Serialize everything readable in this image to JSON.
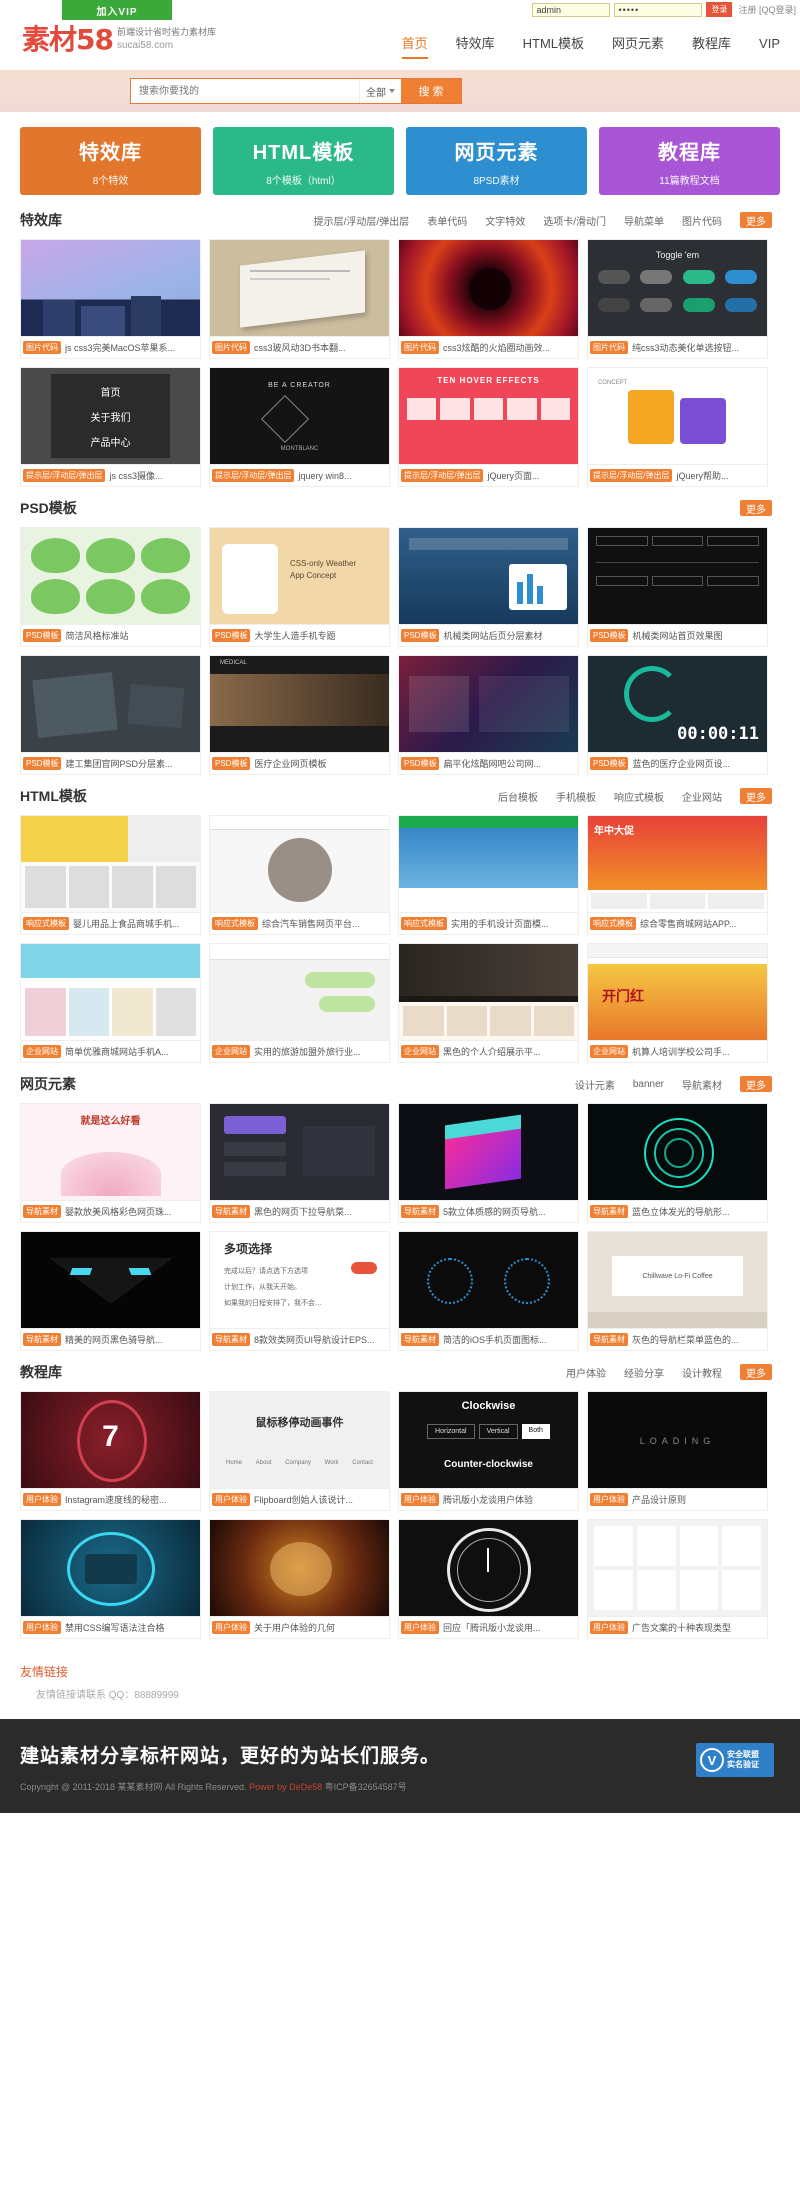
{
  "topbar": {
    "vip_button": "加入VIP",
    "username_value": "admin",
    "password_value": "•••••",
    "login_button": "登录",
    "register_link": "注册 [QQ登录]"
  },
  "header": {
    "logo_main": "素材58",
    "logo_tagline": "前端设计省时省力素材库",
    "logo_url": "sucai58.com",
    "nav": [
      {
        "label": "首页",
        "active": true
      },
      {
        "label": "特效库",
        "active": false
      },
      {
        "label": "HTML模板",
        "active": false
      },
      {
        "label": "网页元素",
        "active": false
      },
      {
        "label": "教程库",
        "active": false
      },
      {
        "label": "VIP",
        "active": false
      }
    ]
  },
  "search": {
    "placeholder": "搜索你要找的",
    "scope": "全部",
    "button": "搜 索"
  },
  "categories": [
    {
      "title": "特效库",
      "subtitle": "8个特效",
      "color": "#e2762c"
    },
    {
      "title": "HTML模板",
      "subtitle": "8个模板（html）",
      "color": "#2bb98a"
    },
    {
      "title": "网页元素",
      "subtitle": "8PSD素材",
      "color": "#2e8fd0"
    },
    {
      "title": "教程库",
      "subtitle": "11篇教程文档",
      "color": "#a855d6"
    }
  ],
  "sections": [
    {
      "title": "特效库",
      "tags": [
        "提示层/浮动层/弹出层",
        "表单代码",
        "文字特效",
        "选项卡/滑动门",
        "导航菜单",
        "图片代码"
      ],
      "more": "更多",
      "cards": [
        {
          "tag": "图片代码",
          "title": "js css3完美MacOS苹果系..."
        },
        {
          "tag": "图片代码",
          "title": "css3玻风动3D书本翻..."
        },
        {
          "tag": "图片代码",
          "title": "css3炫酷的火焰圈动画效..."
        },
        {
          "tag": "图片代码",
          "title": "纯css3动态美化单选按钮..."
        },
        {
          "tag": "提示层/浮动层/弹出层",
          "title": "js css3摄像..."
        },
        {
          "tag": "提示层/浮动层/弹出层",
          "title": "jquery win8..."
        },
        {
          "tag": "提示层/浮动层/弹出层",
          "title": "jQuery页面..."
        },
        {
          "tag": "提示层/浮动层/弹出层",
          "title": "jQuery帮助..."
        }
      ]
    },
    {
      "title": "PSD模板",
      "tags": [],
      "more": "更多",
      "cards": [
        {
          "tag": "PSD模板",
          "title": "简洁风格标准站"
        },
        {
          "tag": "PSD模板",
          "title": "大学生人造手机专题"
        },
        {
          "tag": "PSD模板",
          "title": "机械类网站后页分层素材"
        },
        {
          "tag": "PSD模板",
          "title": "机械类网站首页效果图"
        },
        {
          "tag": "PSD模板",
          "title": "建工集团官网PSD分层素..."
        },
        {
          "tag": "PSD模板",
          "title": "医疗企业网页模板"
        },
        {
          "tag": "PSD模板",
          "title": "扁平化炫酷网吧公司网..."
        },
        {
          "tag": "PSD模板",
          "title": "蓝色的医疗企业网页设..."
        }
      ]
    },
    {
      "title": "HTML模板",
      "tags": [
        "后台模板",
        "手机模板",
        "响应式模板",
        "企业网站"
      ],
      "more": "更多",
      "cards": [
        {
          "tag": "响应式模板",
          "title": "婴儿用品上食品商城手机..."
        },
        {
          "tag": "响应式模板",
          "title": "综合汽车销售网页平台..."
        },
        {
          "tag": "响应式模板",
          "title": "实用的手机设计页面模..."
        },
        {
          "tag": "响应式模板",
          "title": "综合零售商城网站APP..."
        },
        {
          "tag": "企业网站",
          "title": "简单优雅商城网站手机A..."
        },
        {
          "tag": "企业网站",
          "title": "实用的旅游加盟外旅行业..."
        },
        {
          "tag": "企业网站",
          "title": "黑色的个人介绍展示平..."
        },
        {
          "tag": "企业网站",
          "title": "机算人培训学校公司手..."
        }
      ]
    },
    {
      "title": "网页元素",
      "tags": [
        "设计元素",
        "banner",
        "导航素材"
      ],
      "more": "更多",
      "cards": [
        {
          "tag": "导航素材",
          "title": "婴款放美风格彩色网页珠..."
        },
        {
          "tag": "导航素材",
          "title": "黑色的网页下拉导航菜..."
        },
        {
          "tag": "导航素材",
          "title": "5款立体质感的网页导航..."
        },
        {
          "tag": "导航素材",
          "title": "蓝色立体发光的导航形..."
        },
        {
          "tag": "导航素材",
          "title": "精美的网页黑色骑导航..."
        },
        {
          "tag": "导航素材",
          "title": "8款效类网页UI导航设计EPS..."
        },
        {
          "tag": "导航素材",
          "title": "简洁的iOS手机页面图标..."
        },
        {
          "tag": "导航素材",
          "title": "灰色的导航栏菜单蓝色的..."
        }
      ]
    },
    {
      "title": "教程库",
      "tags": [
        "用户体验",
        "经验分享",
        "设计教程"
      ],
      "more": "更多",
      "cards": [
        {
          "tag": "用户体验",
          "title": "Instagram速度线的秘密..."
        },
        {
          "tag": "用户体验",
          "title": "Flipboard创始人该说计..."
        },
        {
          "tag": "用户体验",
          "title": "腾讯版小龙谈用户体验"
        },
        {
          "tag": "用户体验",
          "title": "产品设计原则"
        },
        {
          "tag": "用户体验",
          "title": "禁用CSS编写语法注合格"
        },
        {
          "tag": "用户体验",
          "title": "关于用户体验的几何"
        },
        {
          "tag": "用户体验",
          "title": "回应「腾讯版小龙谈用..."
        },
        {
          "tag": "用户体验",
          "title": "广告文案的十种表现类型"
        }
      ]
    }
  ],
  "friend_links": {
    "title": "友情链接",
    "text": "友情链接请联系 QQ：88889999"
  },
  "footer": {
    "slogan": "建站素材分享标杆网站，更好的为站长们服务。",
    "copyright": "Copyright @ 2011-2018 某某素材网 All Rights Reserved.",
    "power": "Power by DeDe58",
    "icp": "粤ICP备32654587号",
    "seal_line1": "安全联盟",
    "seal_line2": "实名验证",
    "seal_mark": "V"
  }
}
